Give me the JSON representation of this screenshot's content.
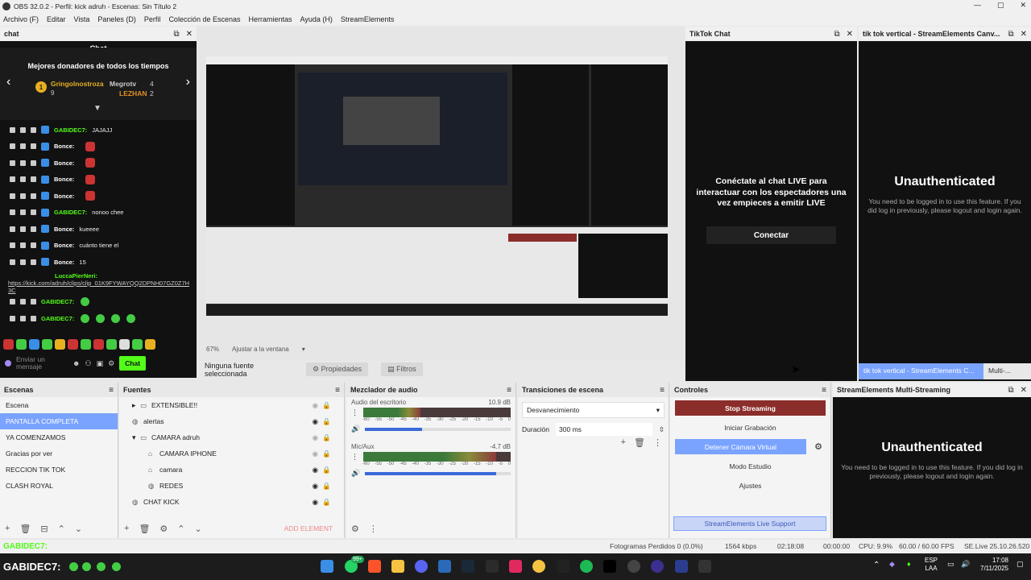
{
  "window": {
    "title": "OBS 32.0.2 - Perfil: kick adruh - Escenas: Sin Título 2",
    "controls": [
      "—",
      "▢",
      "✕"
    ]
  },
  "menu": [
    "Archivo (F)",
    "Editar",
    "Vista",
    "Paneles (D)",
    "Perfil",
    "Colección de Escenas",
    "Herramientas",
    "Ayuda (H)",
    "StreamElements"
  ],
  "chat_dock": {
    "title": "chat",
    "header": "Chat",
    "donors_title": "Mejores donadores de todos los tiempos",
    "donors": [
      {
        "rank": "1",
        "name": "Gringolnostroza",
        "amount": "9"
      },
      {
        "name": "Megrotv",
        "amount": "4"
      },
      {
        "name": "LEZHAN",
        "amount": "2"
      }
    ],
    "messages": [
      {
        "user": "GABIDEC7:",
        "text": "JAJAJJ",
        "user_color": "#53fc18"
      },
      {
        "user": "Bonce:",
        "text": "",
        "user_color": "#ffffff",
        "emote": "red"
      },
      {
        "user": "Bonce:",
        "text": "",
        "user_color": "#ffffff",
        "emote": "red"
      },
      {
        "user": "Bonce:",
        "text": "",
        "user_color": "#ffffff",
        "emote": "red"
      },
      {
        "user": "Bonce:",
        "text": "",
        "user_color": "#ffffff",
        "emote": "red"
      },
      {
        "user": "GABIDEC7:",
        "text": "nonoo chee",
        "user_color": "#53fc18"
      },
      {
        "user": "Bonce:",
        "text": "kueeee",
        "user_color": "#ffffff"
      },
      {
        "user": "Bonce:",
        "text": "cuánto tiene el",
        "user_color": "#ffffff"
      },
      {
        "user": "Bonce:",
        "text": "15",
        "user_color": "#ffffff"
      }
    ],
    "link_user": "LuccaPierNeri:",
    "link_text": "https://kick.com/adruh/clips/clip_01K9FYWAYQQ2DPNH07GZ0Z7H3C",
    "messages2": [
      {
        "user": "GABIDEC7:",
        "emotes": 1
      },
      {
        "user": "GABIDEC7:",
        "emotes": 4
      }
    ],
    "input_placeholder": "Enviar un mensaje",
    "send_label": "Chat"
  },
  "preview": {
    "zoom": "67%",
    "fit_option": "Ajustar a la ventana",
    "no_source": "Ninguna fuente seleccionada",
    "properties_label": "Propiedades",
    "filters_label": "Filtros"
  },
  "tiktok_dock": {
    "title": "TikTok Chat",
    "message": "Conéctate al chat LIVE para interactuar con los espectadores una vez empieces a emitir LIVE",
    "connect_label": "Conectar"
  },
  "canvas_dock": {
    "title": "tik tok vertical - StreamElements Canv...",
    "heading": "Unauthenticated",
    "text": "You need to be logged in to use this feature. If you did log in previously, please logout and login again.",
    "tabs": [
      "tik tok vertical - StreamElements C...",
      "Multi-..."
    ]
  },
  "scenes": {
    "title": "Escenas",
    "items": [
      "Escena",
      "PANTALLA COMPLETA",
      "YA COMENZAMOS",
      "Gracias por ver",
      "RECCION TIK TOK",
      "CLASH ROYAL"
    ],
    "selected": 1
  },
  "sources": {
    "title": "Fuentes",
    "items": [
      {
        "name": "EXTENSIBLE!!",
        "indent": 1,
        "type": "folder",
        "arrow": "▸",
        "visible": false
      },
      {
        "name": "alertas",
        "indent": 0,
        "type": "browser",
        "arrow": "",
        "visible": true
      },
      {
        "name": "CAMARA adruh",
        "indent": 1,
        "type": "folder",
        "arrow": "▾",
        "visible": false
      },
      {
        "name": "CAMARA IPHONE",
        "indent": 2,
        "type": "camera",
        "arrow": "",
        "visible": false
      },
      {
        "name": "camara",
        "indent": 2,
        "type": "camera",
        "arrow": "",
        "visible": true
      },
      {
        "name": "REDES",
        "indent": 2,
        "type": "browser",
        "arrow": "",
        "visible": true
      },
      {
        "name": "CHAT KICK",
        "indent": 0,
        "type": "browser",
        "arrow": "",
        "visible": true
      }
    ],
    "add_element": "ADD ELEMENT"
  },
  "mixer": {
    "title": "Mezclador de audio",
    "channels": [
      {
        "name": "Audio del escritorio",
        "db": "10.9 dB",
        "level": 0.39
      },
      {
        "name": "Mic/Aux",
        "db": "-4.7 dB",
        "level": 0.9
      }
    ],
    "scale": [
      "-60",
      "-55",
      "-50",
      "-45",
      "-40",
      "-35",
      "-30",
      "-25",
      "-20",
      "-15",
      "-10",
      "-5",
      "0"
    ]
  },
  "transitions": {
    "title": "Transiciones de escena",
    "selected": "Desvanecimiento",
    "duration_label": "Duración",
    "duration_value": "300 ms"
  },
  "controls": {
    "title": "Controles",
    "stop_streaming": "Stop Streaming",
    "start_recording": "Iniciar Grabación",
    "virtual_cam": "Detener Cámara Virtual",
    "studio_mode": "Modo Estudio",
    "settings": "Ajustes",
    "support": "StreamElements Live Support"
  },
  "multistream": {
    "title": "StreamElements Multi-Streaming",
    "heading": "Unauthenticated",
    "text": "You need to be logged in to use this feature. If you did log in previously, please logout and login again."
  },
  "statusbar": {
    "left_user": "GABIDEC7:",
    "frames_dropped": "Fotogramas Perdidos 0 (0.0%)",
    "bitrate": "1564 kbps",
    "stream_time": "02:18:08",
    "rec_time": "00:00:00",
    "cpu": "CPU: 9.9%",
    "fps": "60.00 / 60.00 FPS",
    "version": "SE.Live 25.10.26.520"
  },
  "taskbar": {
    "ticker_user": "GABIDEC7:",
    "lang": "ESP",
    "lang_sub": "LAA",
    "time": "17:08",
    "date": "7/11/2025",
    "badge": "99+"
  },
  "colors": {
    "kick_green": "#53fc18",
    "stop_red": "#8b2d2b",
    "virtualcam_blue": "#7aa3ff",
    "selection": "#7aa3ff"
  }
}
